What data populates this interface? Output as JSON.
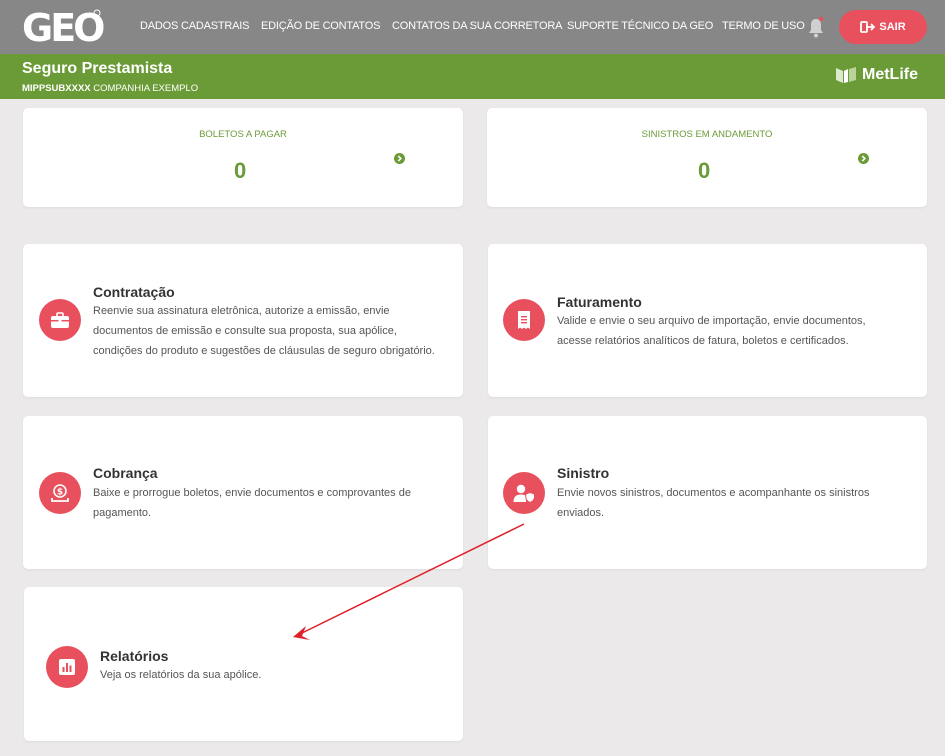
{
  "header": {
    "logo_text": "GEO",
    "nav": [
      "DADOS CADASTRAIS",
      "EDIÇÃO DE CONTATOS",
      "CONTATOS DA SUA CORRETORA",
      "SUPORTE TÉCNICO DA GEO",
      "TERMO DE USO"
    ],
    "logout_label": "SAIR"
  },
  "product": {
    "title": "Seguro Prestamista",
    "code": "MIPPSUBXXXX",
    "company": "COMPANHIA EXEMPLO",
    "insurer": "MetLife"
  },
  "stats": [
    {
      "label": "BOLETOS A PAGAR",
      "value": "0"
    },
    {
      "label": "SINISTROS EM ANDAMENTO",
      "value": "0"
    }
  ],
  "features": [
    {
      "title": "Contratação",
      "icon": "briefcase-icon",
      "lines": [
        "Reenvie sua assinatura eletrônica, autorize a emissão, envie",
        "documentos de emissão e consulte sua proposta, sua apólice,",
        "condições do produto e sugestões de cláusulas de seguro obrigatório."
      ]
    },
    {
      "title": "Faturamento",
      "icon": "invoice-icon",
      "lines": [
        "Valide e envie o seu arquivo de importação, envie documentos,",
        "acesse relatórios analíticos de fatura, boletos e certificados."
      ]
    },
    {
      "title": "Cobrança",
      "icon": "money-icon",
      "lines": [
        "Baixe e prorrogue boletos, envie documentos e comprovantes de",
        "pagamento."
      ]
    },
    {
      "title": "Sinistro",
      "icon": "user-shield-icon",
      "lines": [
        "Envie novos sinistros, documentos e acompanhante os sinistros",
        "enviados."
      ]
    },
    {
      "title": "Relatórios",
      "icon": "bar-chart-icon",
      "lines": [
        "Veja os relatórios da sua apólice."
      ]
    }
  ],
  "colors": {
    "topbar": "#878787",
    "green": "#6b9b37",
    "accent_red": "#e8505e",
    "background": "#ebe9e9"
  }
}
